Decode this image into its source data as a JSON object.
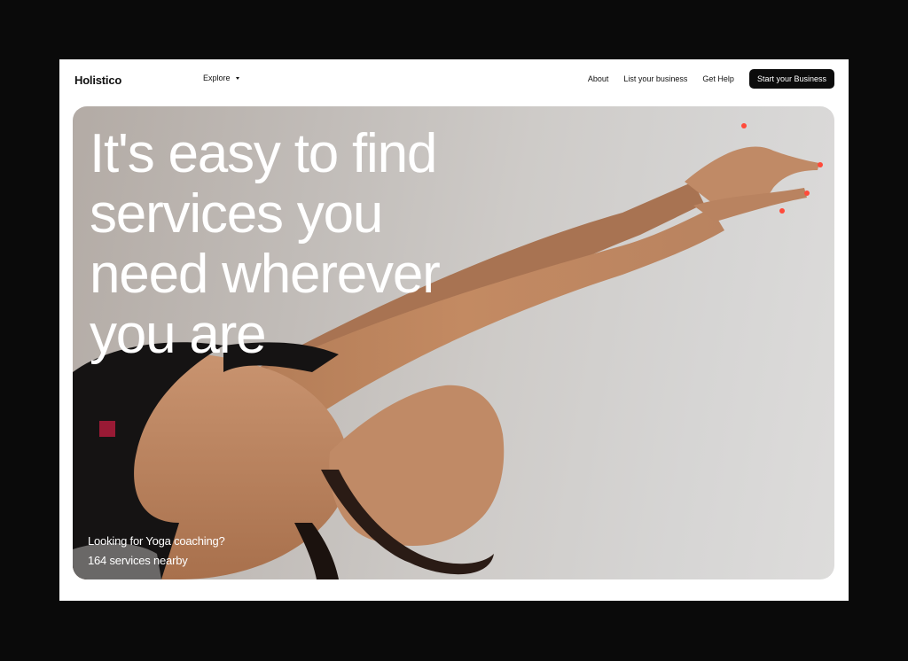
{
  "header": {
    "brand": "Holistico",
    "explore_label": "Explore",
    "links": [
      "About",
      "List your business",
      "Get Help"
    ],
    "cta_label": "Start your Business"
  },
  "hero": {
    "headline_lines": [
      "It's easy to find",
      "services you",
      "need wherever",
      "you are"
    ],
    "subtitle_line1": "Looking for Yoga coaching?",
    "subtitle_line2": "164 services nearby",
    "photo_subject": "woman in black sports top stretching arms upward in yoga pose"
  },
  "colors": {
    "page_bg": "#0a0a0a",
    "frame_bg": "#ffffff",
    "cta_bg": "#0c0c0c",
    "hero_bg": "#c8c5c2",
    "text_on_hero": "#ffffff"
  }
}
